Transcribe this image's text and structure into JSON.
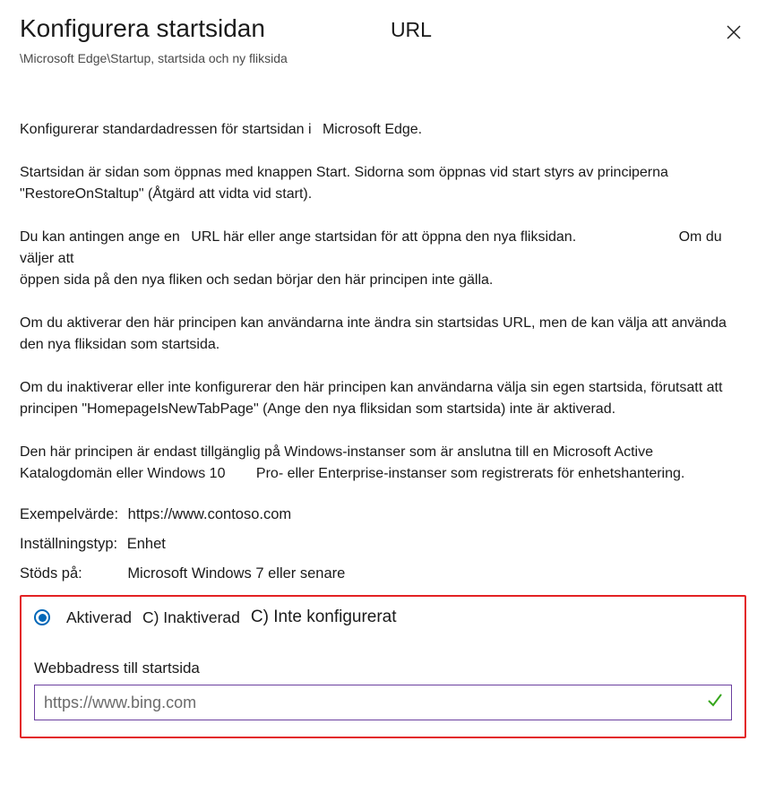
{
  "header": {
    "title": "Konfigurera startsidan",
    "urlLabel": "URL",
    "breadcrumb": "\\Microsoft Edge\\Startup, startsida och ny fliksida"
  },
  "description": {
    "p1a": "Konfigurerar standardadressen för startsidan i",
    "p1b": "Microsoft Edge.",
    "p2": "Startsidan är sidan som öppnas med knappen Start. Sidorna som öppnas vid start styrs av principerna \"RestoreOnStaltup\" (Åtgärd att vidta vid start).",
    "p3a": "Du kan antingen ange en",
    "p3b": "URL här eller ange startsidan för att öppna den nya fliksidan.",
    "p3c": "Om du väljer att",
    "p3d": "öppen sida på den nya fliken och sedan börjar den här principen inte gälla.",
    "p4": "Om du aktiverar den här principen kan användarna inte ändra sin startsidas URL, men de kan välja att använda den nya fliksidan som startsida.",
    "p5": "Om du inaktiverar eller inte konfigurerar den här principen kan användarna välja sin egen startsida, förutsatt att principen \"HomepageIsNewTabPage\" (Ange den nya fliksidan som startsida) inte är aktiverad.",
    "p6a": "Den här principen är endast tillgänglig på Windows-instanser som är anslutna till en Microsoft Active Katalogdomän eller Windows 10",
    "p6b": "Pro- eller Enterprise-instanser som registrerats för enhetshantering."
  },
  "meta": {
    "exampleLabel": "Exempelvärde:",
    "exampleValue": "https://www.contoso.com",
    "settingTypeLabel": "Inställningstyp:",
    "settingTypeValue": "Enhet",
    "supportedLabel": "Stöds på:",
    "supportedValue": "Microsoft Windows 7 eller senare"
  },
  "config": {
    "options": {
      "enabled": "Aktiverad",
      "disabled": "C) Inaktiverad",
      "notConfigured": "C) Inte konfigurerat"
    },
    "fieldLabel": "Webbadress till startsida",
    "fieldValue": "https://www.bing.com"
  }
}
